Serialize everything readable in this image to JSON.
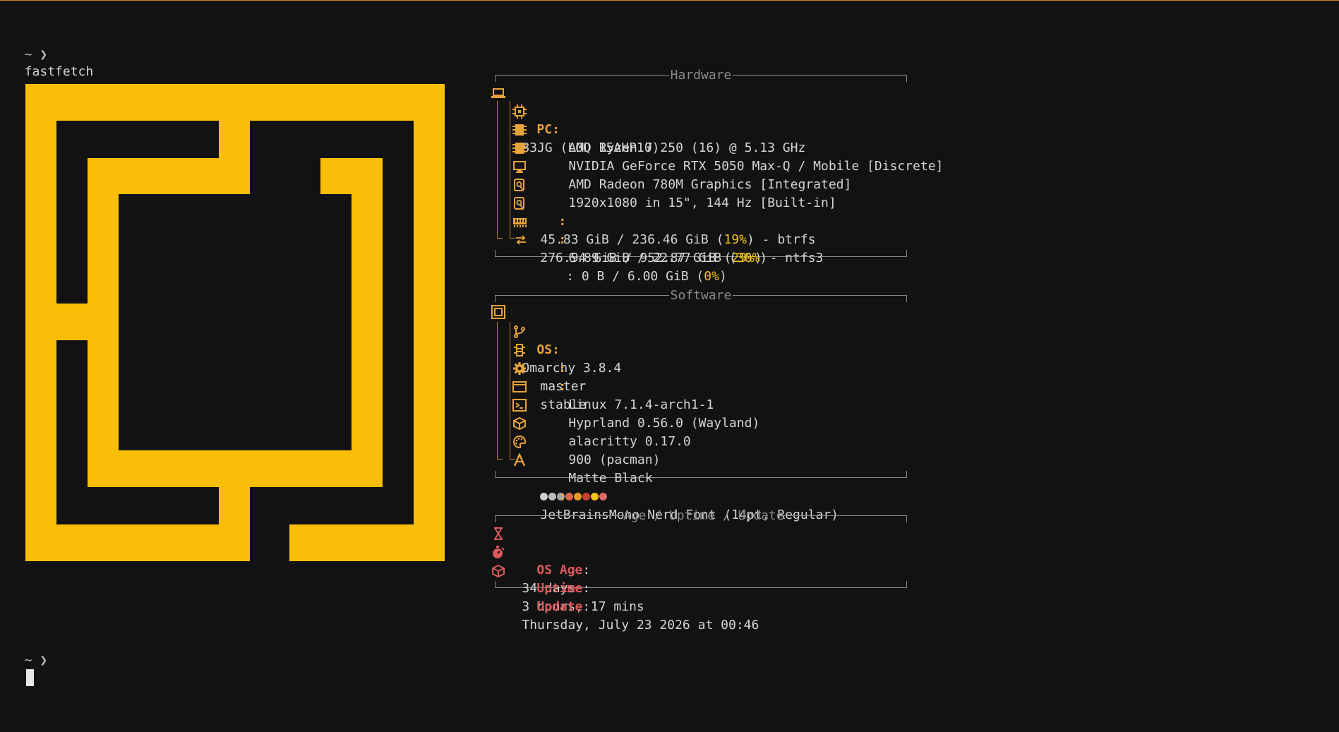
{
  "terminal": {
    "prompt_symbol": "~ ❯",
    "command": "fastfetch",
    "second_prompt_symbol": "~ ❯"
  },
  "colors": {
    "logo": "#fbbe08",
    "accent": "#e8a33a",
    "section_title": "#8a8a8a",
    "percent": "#f2c418",
    "age_key": "#d95a5a"
  },
  "hardware": {
    "title": "Hardware",
    "pc_key": "PC",
    "pc_value": "83JG (LOQ 15AHP10)",
    "items": [
      {
        "icon": "cpu-icon",
        "value": "AMD Ryzen 7 250 (16) @ 5.13 GHz"
      },
      {
        "icon": "gpu-icon",
        "value": "NVIDIA GeForce RTX 5050 Max-Q / Mobile [Discrete]"
      },
      {
        "icon": "gpu-icon",
        "value": "AMD Radeon 780M Graphics [Integrated]"
      },
      {
        "icon": "display-icon",
        "value": "1920x1080 in 15\", 144 Hz [Built-in]"
      }
    ],
    "disk1": {
      "icon": "disk-icon",
      "pre": "45.83 GiB / 236.46 GiB (",
      "pct": "19%",
      "post": ") - btrfs"
    },
    "disk2": {
      "icon": "disk-icon",
      "pre": "276.94 GiB / 952.87 GiB (",
      "pct": "29%",
      "post": ") - ntfs3"
    },
    "memory": {
      "icon": "memory-icon",
      "pre": "6.89 GiB / 22.77 GiB (",
      "pct": "30%",
      "post": ")"
    },
    "swap": {
      "icon": "swap-icon",
      "pre": " : 0 B / 6.00 GiB (",
      "pct": "0%",
      "post": ")"
    }
  },
  "software": {
    "title": "Software",
    "os_key": "OS",
    "os_value": "Omarchy 3.8.4",
    "items": [
      {
        "icon": "git-branch-icon",
        "value": "master"
      },
      {
        "icon": "channel-icon",
        "value": "stable"
      },
      {
        "icon": "kernel-gear-icon",
        "value": "Linux 7.1.4-arch1-1"
      },
      {
        "icon": "window-manager-icon",
        "value": "Hyprland 0.56.0 (Wayland)"
      },
      {
        "icon": "terminal-icon",
        "value": "alacritty 0.17.0"
      },
      {
        "icon": "package-icon",
        "value": "900 (pacman)"
      },
      {
        "icon": "palette-icon",
        "value": "Matte Black"
      },
      {
        "icon": "font-icon",
        "value": "JetBrainsMono Nerd Font (14pt, Regular)"
      }
    ],
    "theme_dots": [
      "#cfcfcf",
      "#bdbdbd",
      "#a8a8a8",
      "#d9674a",
      "#e89a2a",
      "#c9412f",
      "#f2c418",
      "#e06a6a"
    ]
  },
  "age": {
    "title": "Age / Uptime / Update",
    "rows": [
      {
        "icon": "hourglass-icon",
        "key": "OS Age",
        "value": "34 days"
      },
      {
        "icon": "stopwatch-icon",
        "key": "Uptime",
        "value": "3 hours, 17 mins"
      },
      {
        "icon": "box-icon",
        "key": "Update",
        "value": "Thursday, July 23 2026 at 00:46"
      }
    ]
  }
}
